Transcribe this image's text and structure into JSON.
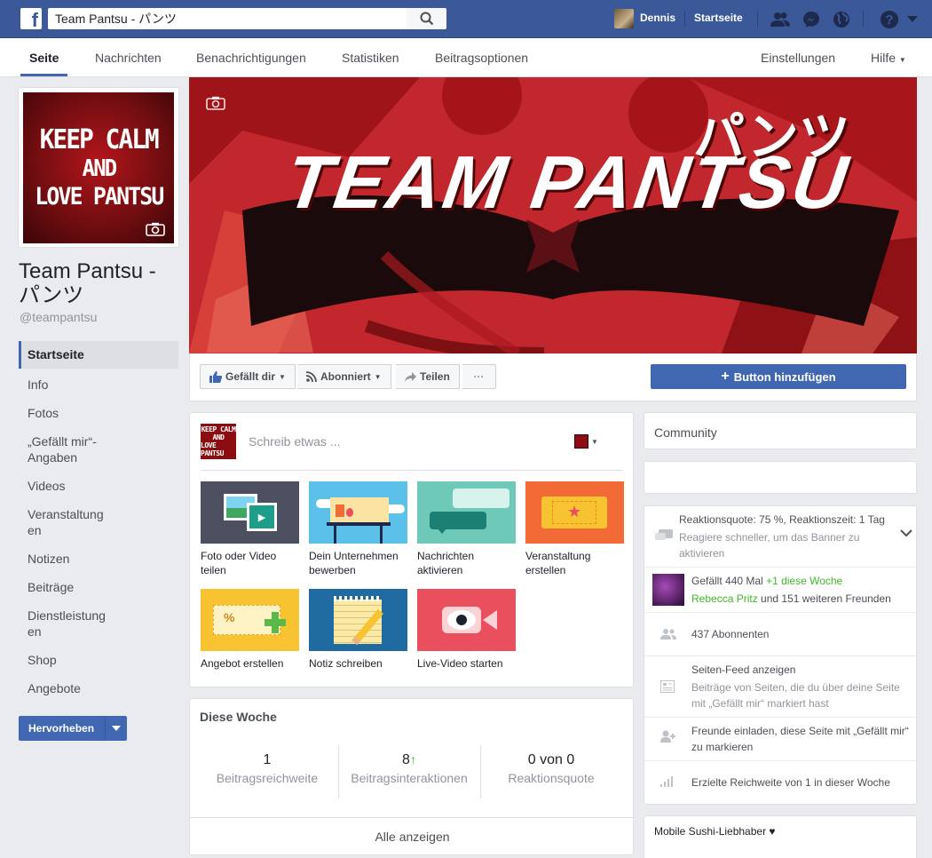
{
  "topbar": {
    "search_value": "Team Pantsu - パンツ",
    "user_name": "Dennis",
    "home_label": "Startseite",
    "icons": [
      "friends-icon",
      "messenger-icon",
      "globe-icon",
      "help-icon",
      "caret-icon"
    ]
  },
  "pagenav": {
    "tabs": [
      "Seite",
      "Nachrichten",
      "Benachrichtigungen",
      "Statistiken",
      "Beitragsoptionen"
    ],
    "settings": "Einstellungen",
    "help": "Hilfe"
  },
  "profile": {
    "pic_lines": [
      "KEEP CALM",
      "AND",
      "LOVE PANTSU"
    ],
    "name": "Team Pantsu - パンツ",
    "handle": "@teampantsu"
  },
  "leftnav": {
    "items": [
      "Startseite",
      "Info",
      "Fotos",
      "„Gefällt mir“-Angaben",
      "Videos",
      "Veranstaltungen",
      "Notizen",
      "Beiträge",
      "Dienstleistungen",
      "Shop",
      "Angebote"
    ],
    "promote": "Hervorheben"
  },
  "cover": {
    "title": "TEAM PANTSU",
    "kana": "パンツ"
  },
  "actions": {
    "like": "Gefällt dir",
    "follow": "Abonniert",
    "share": "Teilen",
    "more": "···",
    "add_button": "Button hinzufügen"
  },
  "composer": {
    "placeholder": "Schreib etwas ...",
    "tiles": [
      {
        "label": "Foto oder Video teilen",
        "color": "#4b4f5f"
      },
      {
        "label": "Dein Unternehmen bewerben",
        "color": "#5bc1e8"
      },
      {
        "label": "Nachrichten aktivieren",
        "color": "#6ec9b9"
      },
      {
        "label": "Veranstaltung erstellen",
        "color": "#f26a35"
      },
      {
        "label": "Angebot erstellen",
        "color": "#f7c331"
      },
      {
        "label": "Notiz schreiben",
        "color": "#1f6aa0"
      },
      {
        "label": "Live-Video starten",
        "color": "#e94f5d"
      }
    ]
  },
  "thisweek": {
    "title": "Diese Woche",
    "stats": [
      {
        "value": "1",
        "label": "Beitragsreichweite"
      },
      {
        "value": "8",
        "label": "Beitragsinteraktionen"
      },
      {
        "value": "0 von 0",
        "label": "Reaktionsquote"
      }
    ],
    "see_all": "Alle anzeigen"
  },
  "right": {
    "community": "Community",
    "response": {
      "line1": "Reaktionsquote: 75 %, Reaktionszeit: 1 Tag",
      "line2": "Reagiere schneller, um das Banner zu aktivieren"
    },
    "likes": {
      "count": "Gefällt 440 Mal",
      "delta": "+1 diese Woche",
      "friend": "Rebecca Pritz",
      "rest": "und 151 weiteren Freunden"
    },
    "followers": "437 Abonnenten",
    "feed": {
      "title": "Seiten-Feed anzeigen",
      "desc": "Beiträge von Seiten, die du über deine Seite mit „Gefällt mir“ markiert hast"
    },
    "invite": "Freunde einladen, diese Seite mit „Gefällt mir“ zu markieren",
    "reach": "Erzielte Reichweite von 1 in dieser Woche",
    "mobile": "Mobile Sushi-Liebhaber ♥"
  }
}
